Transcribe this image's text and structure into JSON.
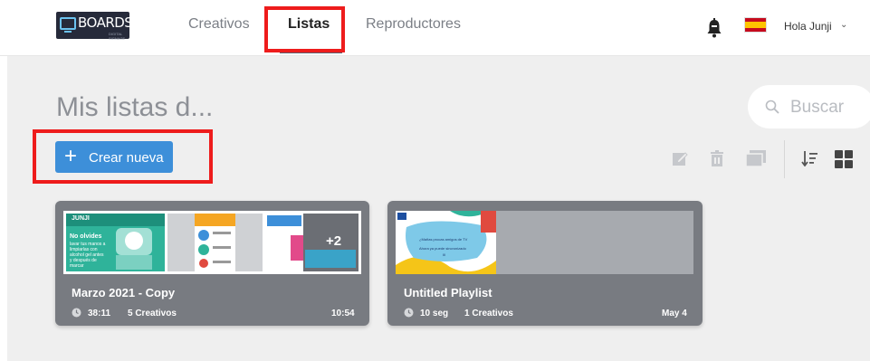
{
  "header": {
    "logo_text": "BOARDS",
    "logo_sub": "DIGITAL SIGNAGE",
    "nav": [
      {
        "label": "Creativos"
      },
      {
        "label": "Listas"
      },
      {
        "label": "Reproductores"
      }
    ],
    "active_nav": "Listas",
    "user_greeting": "Hola Junji",
    "user_menu_icon": "chevron-down-icon",
    "notification_icon": "bell-icon",
    "language_flag": "spain-flag"
  },
  "main": {
    "page_title": "Mis listas d...",
    "search": {
      "placeholder": "Buscar"
    },
    "create_button": {
      "label": "Crear nueva"
    },
    "toolbar_icons": [
      "edit-icon",
      "trash-icon",
      "copy-icon",
      "sort-icon",
      "grid-view-icon"
    ],
    "playlists": [
      {
        "name": "Marzo 2021 - Copy",
        "duration": "38:11",
        "creatives": "5 Creativos",
        "date": "10:54",
        "extra_count": "+2",
        "thumb_texts": [
          "JUNJI",
          "No olvides",
          "lavar tus manos a",
          "limpiarlas con",
          "alcohol gel antes",
          "y después de",
          "marcar"
        ]
      },
      {
        "name": "Untitled Playlist",
        "duration": "10 seg",
        "creatives": "1 Creativos",
        "date": "May 4",
        "thumb_texts": [
          "¿Mañas procas amigos de TV",
          "Ahora ya puede sincronizado",
          "III"
        ]
      }
    ]
  },
  "colors": {
    "primary": "#3d8fd9",
    "highlight": "#ee1c1c",
    "card_bg": "#787b81",
    "page_bg": "#efefef"
  }
}
